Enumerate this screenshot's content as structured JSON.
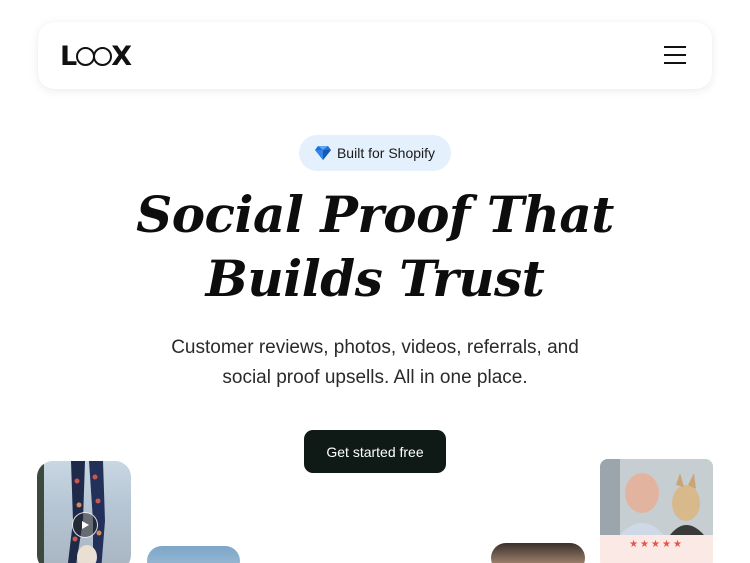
{
  "brand": {
    "logo_text": "LOOX"
  },
  "header": {
    "menu_icon": "hamburger-menu-icon"
  },
  "hero": {
    "badge_icon": "diamond-gem-icon",
    "badge_label": "Built for Shopify",
    "headline_line1": "Social Proof That",
    "headline_line2": "Builds Trust",
    "subtext_line1": "Customer reviews, photos, videos, referrals, and",
    "subtext_line2": "social proof upsells. All in one place.",
    "cta_label": "Get started free"
  },
  "review_cards": {
    "play_icon": "play-icon",
    "rating_stars": "★★★★★",
    "rating_value": 5,
    "star_color": "#e2574c"
  },
  "colors": {
    "badge_background": "#e4f0fb",
    "cta_background": "#0f1a17",
    "text": "#0d0d0d"
  }
}
